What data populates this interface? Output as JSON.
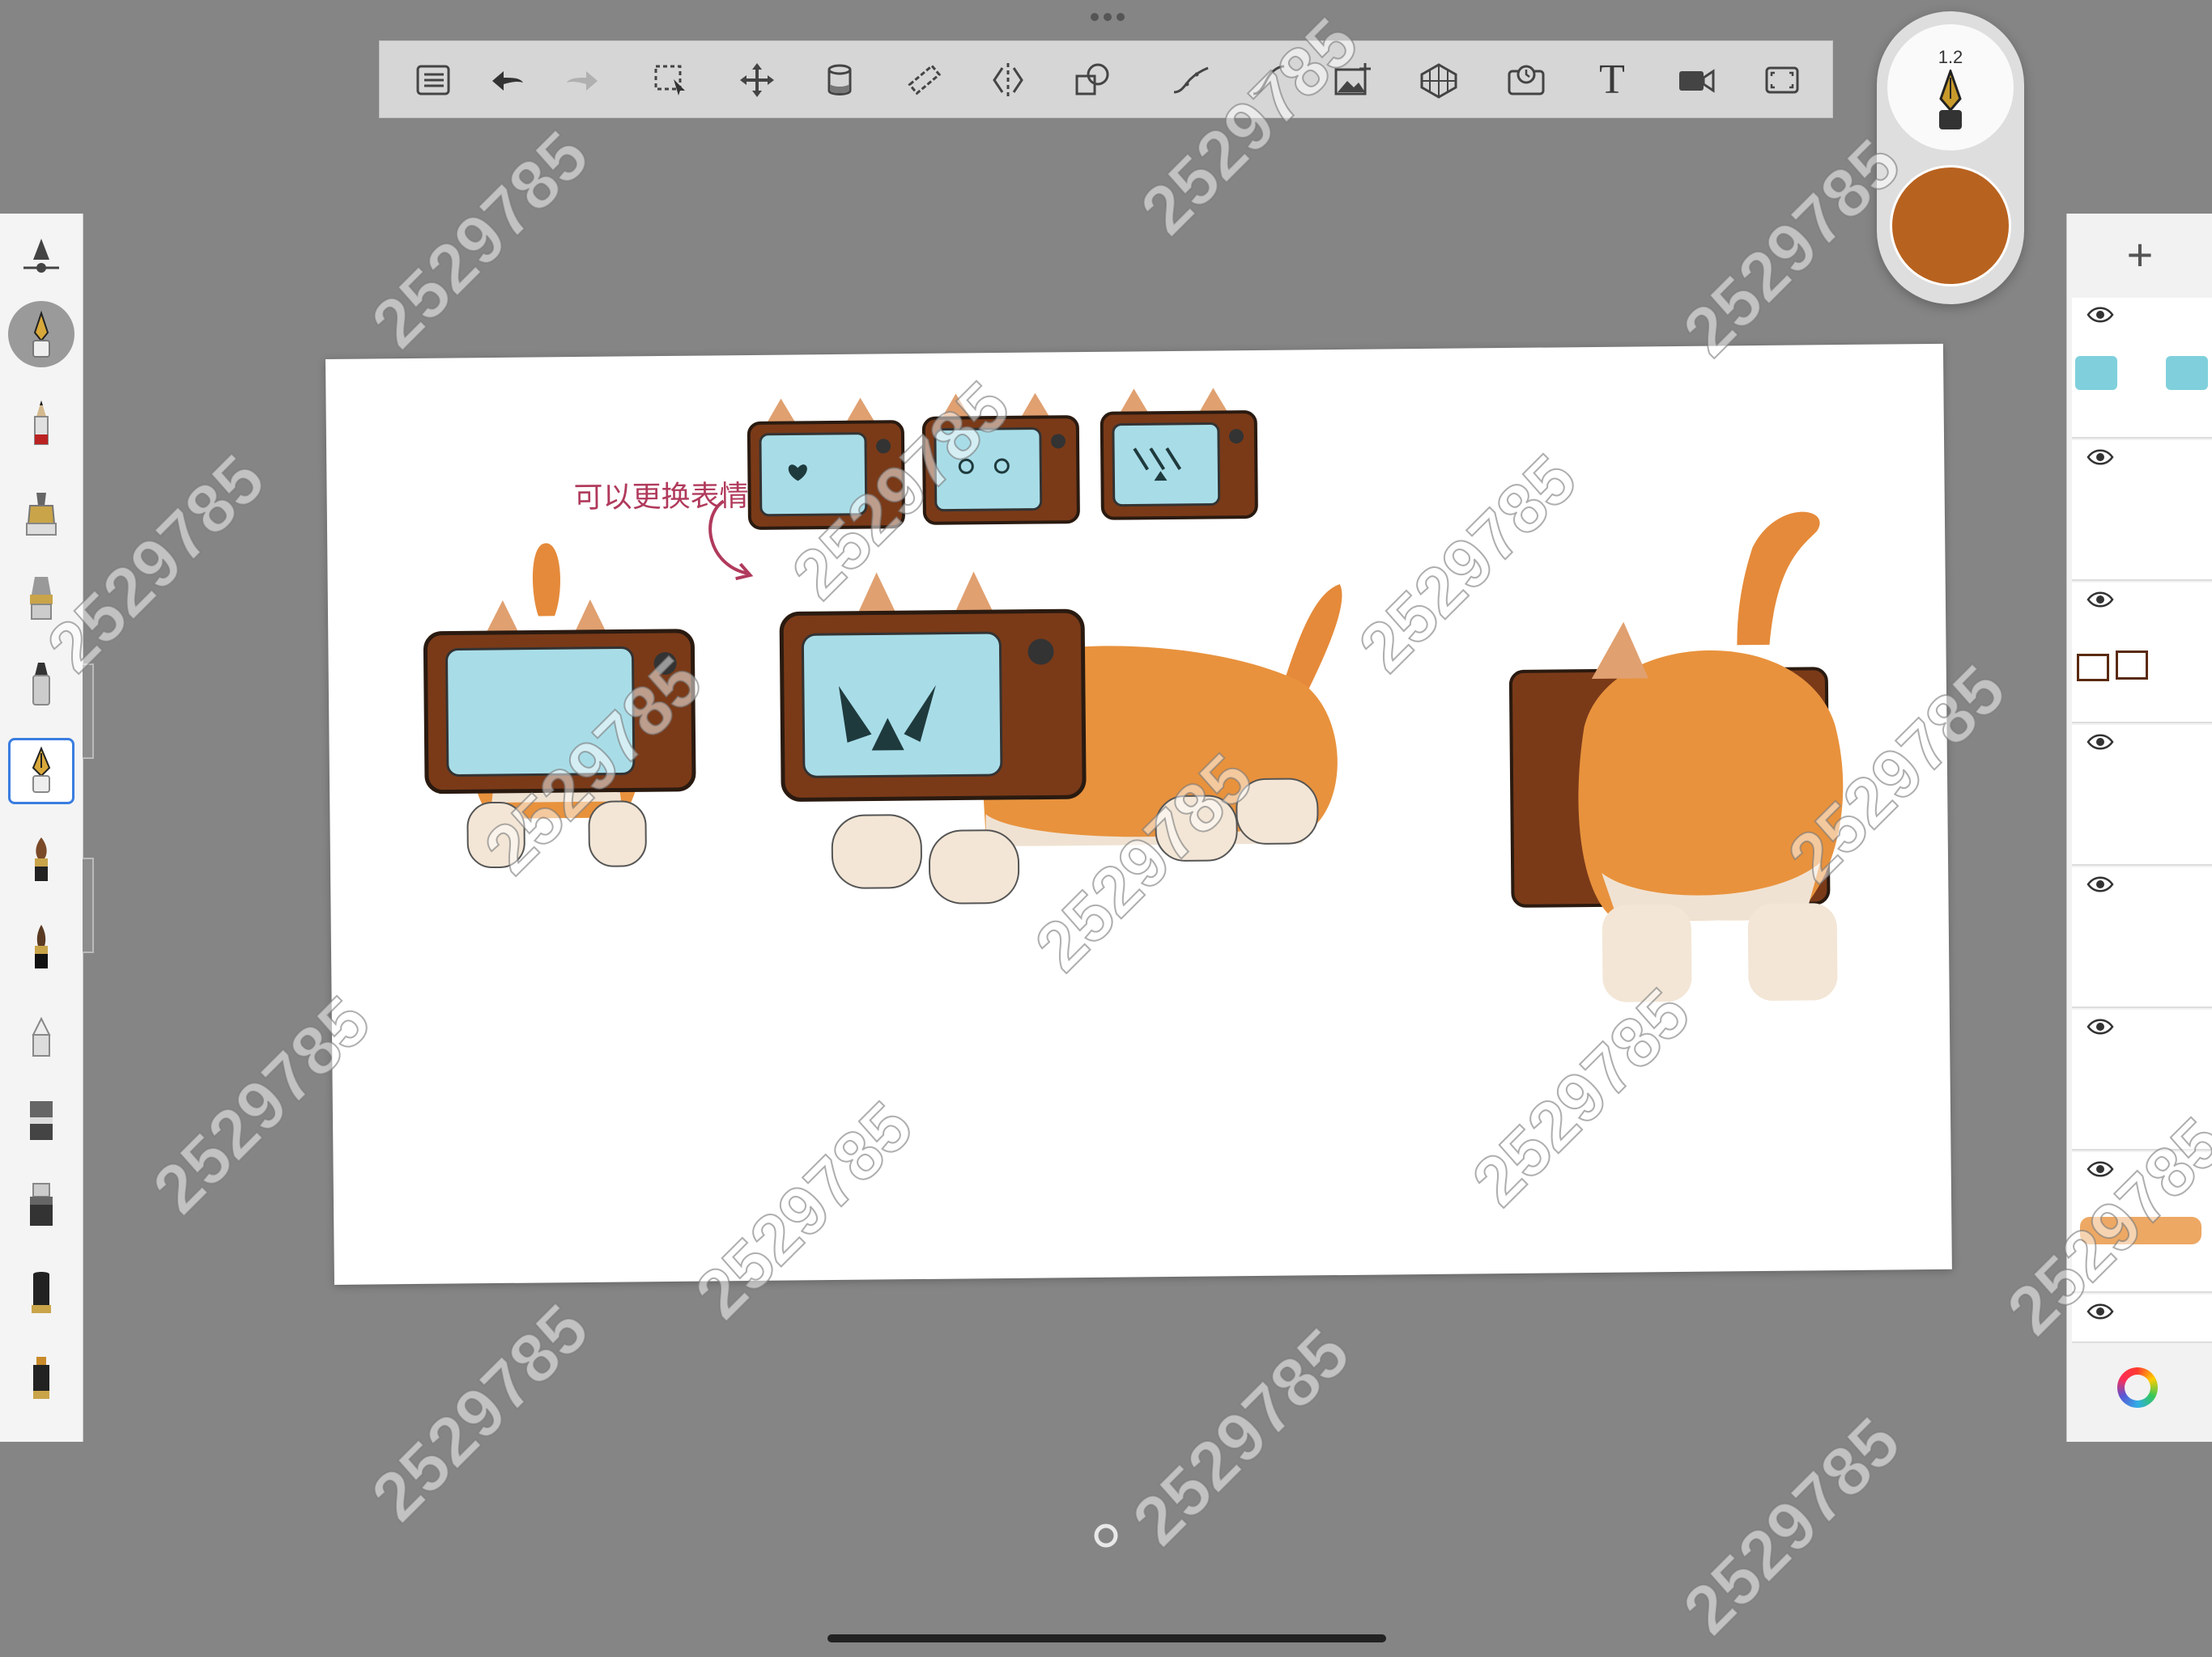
{
  "toolbar": {
    "tools": [
      {
        "name": "menu-icon"
      },
      {
        "name": "undo-icon"
      },
      {
        "name": "redo-icon"
      },
      {
        "name": "selection-icon"
      },
      {
        "name": "transform-icon"
      },
      {
        "name": "fill-icon"
      },
      {
        "name": "ruler-icon"
      },
      {
        "name": "symmetry-icon"
      },
      {
        "name": "shapes-icon"
      },
      {
        "name": "predictive-stroke-icon"
      },
      {
        "name": "steady-stroke-icon"
      },
      {
        "name": "image-import-icon"
      },
      {
        "name": "perspective-icon"
      },
      {
        "name": "time-lapse-icon"
      },
      {
        "name": "text-icon",
        "label": "T"
      },
      {
        "name": "video-icon"
      },
      {
        "name": "fullscreen-icon"
      }
    ]
  },
  "brush_puck": {
    "size_value": "1.2",
    "current_color": "#b8621f"
  },
  "brushes": [
    "brush-settings",
    "recent-pen",
    "pencil",
    "airbrush",
    "paint-brush",
    "marker",
    "fountain-pen",
    "paint-brush-dark",
    "ink-brush",
    "eraser-pointed",
    "smudge-tool",
    "blender",
    "chisel-marker",
    "flat-marker"
  ],
  "canvas": {
    "annotation_text": "可以更换表情"
  },
  "layers": {
    "add_label": "+",
    "count": 8
  },
  "watermark": "2529785"
}
